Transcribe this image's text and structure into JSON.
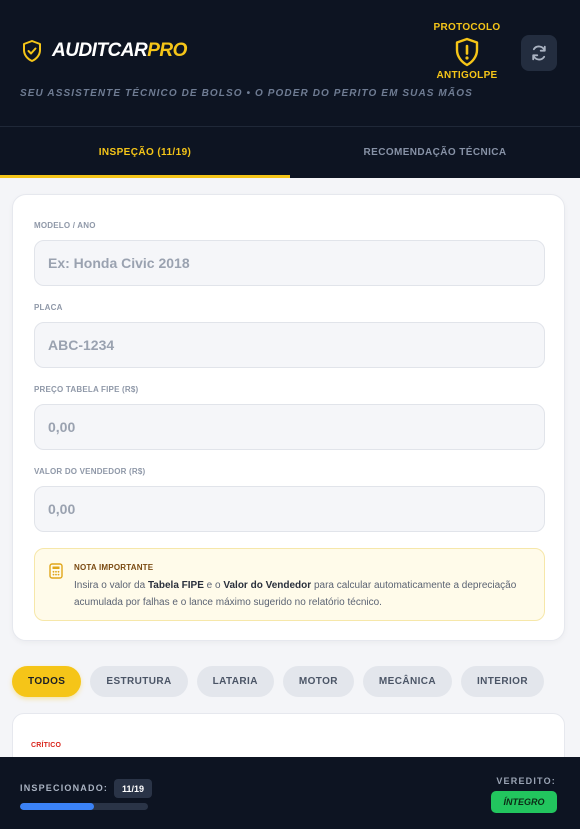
{
  "header": {
    "brand_main": "AUDITCAR",
    "brand_accent": "PRO",
    "tagline": "SEU ASSISTENTE TÉCNICO DE BOLSO • O PODER DO PERITO EM SUAS MÃOS",
    "protocol_top": "PROTOCOLO",
    "protocol_bottom": "ANTIGOLPE",
    "logo_icon": "shield-check-icon",
    "protocol_icon": "shield-alert-icon",
    "refresh_icon": "refresh-icon"
  },
  "tabs": [
    {
      "label": "INSPEÇÃO (11/19)",
      "active": true
    },
    {
      "label": "RECOMENDAÇÃO TÉCNICA",
      "active": false
    }
  ],
  "form": {
    "modelo": {
      "label": "MODELO / ANO",
      "placeholder": "Ex: Honda Civic 2018",
      "value": ""
    },
    "placa": {
      "label": "PLACA",
      "placeholder": "ABC-1234",
      "value": ""
    },
    "preco_fipe": {
      "label": "PREÇO TABELA FIPE (R$)",
      "placeholder": "0,00",
      "value": ""
    },
    "valor_vendedor": {
      "label": "VALOR DO VENDEDOR (R$)",
      "placeholder": "0,00",
      "value": ""
    }
  },
  "note": {
    "icon": "calculator-icon",
    "title": "NOTA IMPORTANTE",
    "text_1": "Insira o valor da ",
    "bold_1": "Tabela FIPE",
    "text_2": " e o ",
    "bold_2": "Valor do Vendedor",
    "text_3": " para calcular automaticamente a depreciação acumulada por falhas e o lance máximo sugerido no relatório técnico."
  },
  "filters": [
    {
      "label": "TODOS",
      "active": true
    },
    {
      "label": "ESTRUTURA",
      "active": false
    },
    {
      "label": "LATARIA",
      "active": false
    },
    {
      "label": "MOTOR",
      "active": false
    },
    {
      "label": "MECÂNICA",
      "active": false
    },
    {
      "label": "INTERIOR",
      "active": false
    }
  ],
  "item": {
    "severity": "CRÍTICO"
  },
  "footer": {
    "inspected_label": "INSPECIONADO:",
    "inspected_count": "11/19",
    "progress_fraction": 0.579,
    "verdict_label": "VEREDITO:",
    "verdict_value": "ÍNTEGRO"
  },
  "colors": {
    "header_bg": "#0d1422",
    "accent": "#f5c518",
    "progress": "#3b82f6",
    "verdict": "#22c55e",
    "critical": "#d9251c"
  }
}
